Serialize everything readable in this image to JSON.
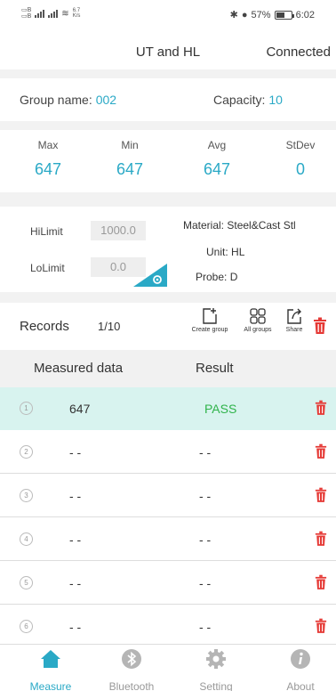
{
  "status_bar": {
    "network_speed_value": "6.7",
    "network_speed_unit": "K/s",
    "battery": "57%",
    "time": "6:02"
  },
  "header": {
    "title": "UT and HL",
    "connection": "Connected"
  },
  "group": {
    "name_label": "Group name:",
    "name_value": "002",
    "capacity_label": "Capacity:",
    "capacity_value": "10"
  },
  "stats": {
    "max_label": "Max",
    "max_value": "647",
    "min_label": "Min",
    "min_value": "647",
    "avg_label": "Avg",
    "avg_value": "647",
    "stdev_label": "StDev",
    "stdev_value": "0"
  },
  "limits": {
    "hi_label": "HiLimit",
    "hi_value": "1000.0",
    "lo_label": "LoLimit",
    "lo_value": "0.0"
  },
  "material": {
    "material_label": "Material:",
    "material_value": "Steel&Cast Stl",
    "unit_label": "Unit:",
    "unit_value": "HL",
    "probe_label": "Probe:",
    "probe_value": "D"
  },
  "records": {
    "label": "Records",
    "count": "1/10",
    "create_group": "Create group",
    "all_groups": "All groups",
    "share": "Share"
  },
  "table": {
    "col_measured": "Measured data",
    "col_result": "Result",
    "rows": [
      {
        "index": "1",
        "value": "647",
        "result": "PASS"
      },
      {
        "index": "2",
        "value": "- -",
        "result": "- -"
      },
      {
        "index": "3",
        "value": "- -",
        "result": "- -"
      },
      {
        "index": "4",
        "value": "- -",
        "result": "- -"
      },
      {
        "index": "5",
        "value": "- -",
        "result": "- -"
      },
      {
        "index": "6",
        "value": "- -",
        "result": "- -"
      }
    ]
  },
  "nav": {
    "measure": "Measure",
    "bluetooth": "Bluetooth",
    "setting": "Setting",
    "about": "About"
  },
  "colors": {
    "accent": "#2aa9c6",
    "pass": "#2fb34a",
    "delete": "#e53935"
  }
}
